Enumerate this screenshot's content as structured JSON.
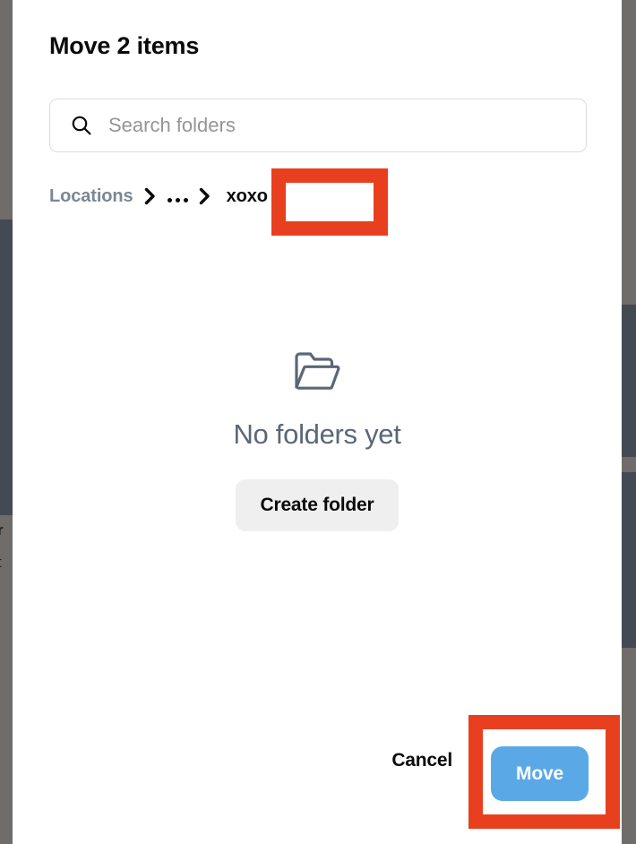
{
  "dialog": {
    "title": "Move 2 items"
  },
  "search": {
    "placeholder": "Search folders",
    "value": "",
    "icon": "search-icon"
  },
  "breadcrumb": {
    "root_label": "Locations",
    "ellipsis_label": "...",
    "current_label": "xoxo",
    "separator_icon": "chevron-right-icon"
  },
  "empty_state": {
    "icon": "open-folder-icon",
    "title": "No folders yet",
    "create_label": "Create folder"
  },
  "footer": {
    "cancel_label": "Cancel",
    "move_label": "Move"
  },
  "background_page": {
    "fragment_1": "r",
    "fragment_2": "t"
  },
  "colors": {
    "annotation_red": "#e8401f",
    "primary_blue": "#5aa9e6",
    "muted_slate": "#5b6776",
    "breadcrumb_gray": "#7b8794",
    "button_gray": "#efefef",
    "backdrop_gray": "#6f6c6a",
    "backdrop_dark": "#434a53"
  }
}
